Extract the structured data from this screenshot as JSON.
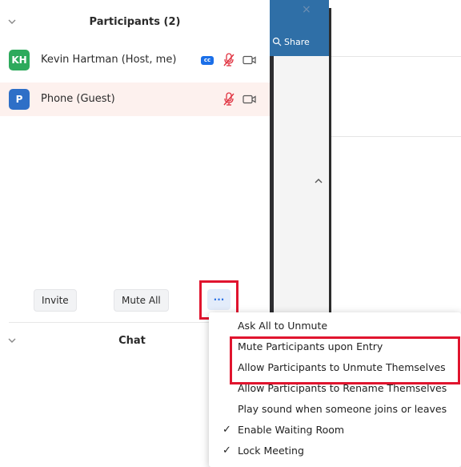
{
  "participants": {
    "title": "Participants (2)",
    "list": [
      {
        "initials": "KH",
        "name": "Kevin Hartman (Host, me)",
        "avatar_color": "#2daa5c",
        "cc": "cc",
        "muted": true,
        "video_off": true,
        "highlighted": false
      },
      {
        "initials": "P",
        "name": "Phone (Guest)",
        "avatar_color": "#2e6fc7",
        "muted": true,
        "video_off": true,
        "highlighted": true
      }
    ],
    "invite_label": "Invite",
    "mute_all_label": "Mute All",
    "more_label": "..."
  },
  "chat": {
    "title": "Chat"
  },
  "meeting_window": {
    "share_label": "Share",
    "close_glyph": "×"
  },
  "more_menu": {
    "items": [
      {
        "label": "Ask All to Unmute",
        "checked": false
      },
      {
        "label": "Mute Participants upon Entry",
        "checked": false
      },
      {
        "label": "Allow Participants to Unmute Themselves",
        "checked": false
      },
      {
        "label": "Allow Participants to Rename Themselves",
        "checked": false
      },
      {
        "label": "Play sound when someone joins or leaves",
        "checked": false
      },
      {
        "label": "Enable Waiting Room",
        "checked": true
      },
      {
        "label": "Lock Meeting",
        "checked": true
      }
    ],
    "check_glyph": "✓"
  },
  "colors": {
    "highlight": "#e0142e",
    "accent": "#2d74e6",
    "muted_icon": "#e0313f"
  }
}
